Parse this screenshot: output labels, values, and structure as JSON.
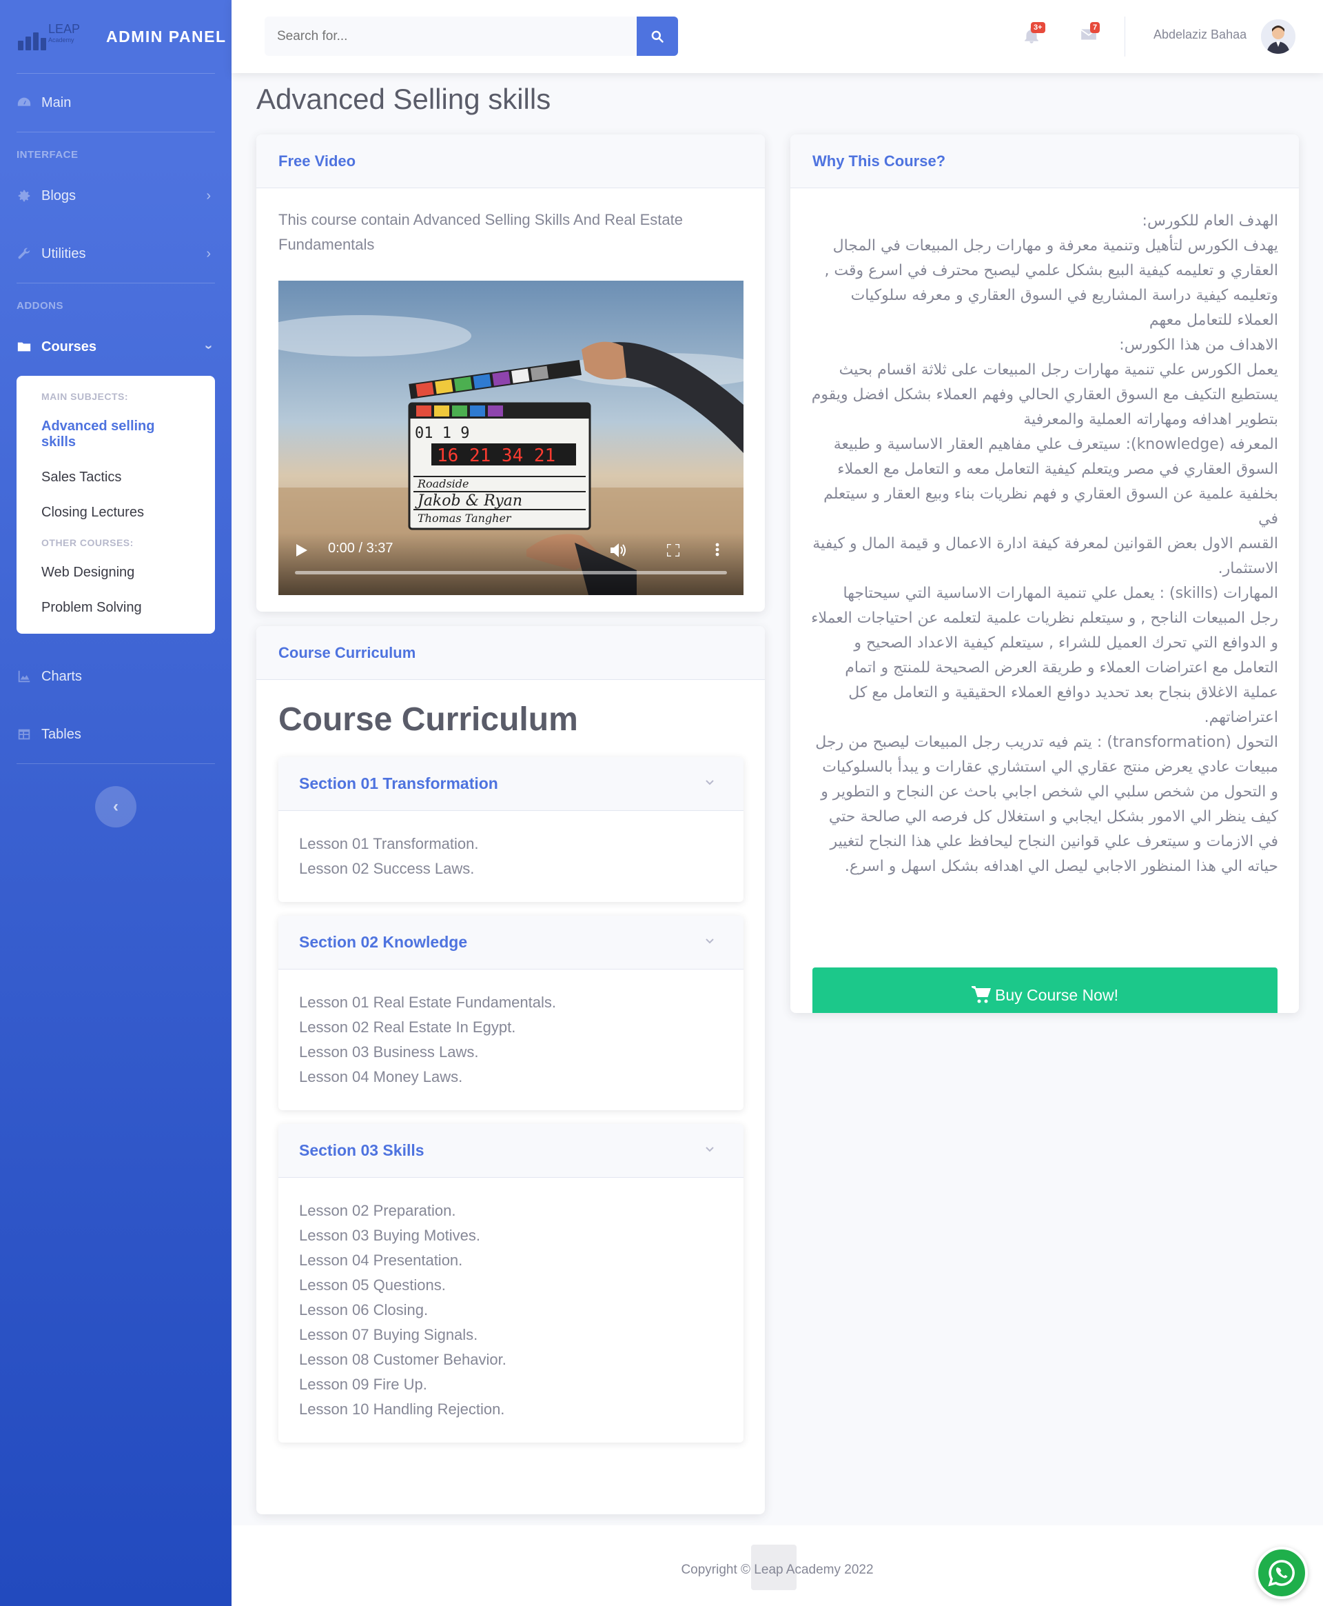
{
  "brand": {
    "logo_text": "LEAP",
    "logo_sub": "Academy",
    "title": "ADMIN PANEL"
  },
  "sidebar": {
    "main": "Main",
    "heading_interface": "INTERFACE",
    "blogs": "Blogs",
    "utilities": "Utilities",
    "heading_addons": "ADDONS",
    "courses": "Courses",
    "submenu": {
      "heading_main": "MAIN SUBJECTS:",
      "items_main": [
        "Advanced selling skills",
        "Sales Tactics",
        "Closing Lectures"
      ],
      "heading_other": "OTHER COURSES:",
      "items_other": [
        "Web Designing",
        "Problem Solving"
      ]
    },
    "charts": "Charts",
    "tables": "Tables"
  },
  "topbar": {
    "search_placeholder": "Search for...",
    "alerts_count": "3+",
    "messages_count": "7",
    "user_name": "Abdelaziz Bahaa"
  },
  "page": {
    "title": "Advanced Selling skills"
  },
  "free_video": {
    "header": "Free Video",
    "description": "This course contain Advanced Selling Skills And Real Estate Fundamentals",
    "time": "0:00 / 3:37",
    "clapper": {
      "row1": "01    1     9",
      "counter": "16 21 34 21",
      "line1": "Roadside",
      "line2": "Jakob & Ryan",
      "line3": "Thomas Tangher"
    }
  },
  "curriculum": {
    "header": "Course Curriculum",
    "title": "Course Curriculum",
    "sections": [
      {
        "title": "Section 01 Transformation",
        "lessons": [
          "Lesson 01 Transformation.",
          "Lesson 02 Success Laws."
        ]
      },
      {
        "title": "Section 02 Knowledge",
        "lessons": [
          "Lesson 01 Real Estate Fundamentals.",
          "Lesson 02 Real Estate In Egypt.",
          "Lesson 03 Business Laws.",
          "Lesson 04 Money Laws."
        ]
      },
      {
        "title": "Section 03 Skills",
        "lessons": [
          "Lesson 02 Preparation.",
          "Lesson 03 Buying Motives.",
          "Lesson 04 Presentation.",
          "Lesson 05 Questions.",
          "Lesson 06 Closing.",
          "Lesson 07 Buying Signals.",
          "Lesson 08 Customer Behavior.",
          "Lesson 09 Fire Up.",
          "Lesson 10 Handling Rejection."
        ]
      }
    ]
  },
  "why": {
    "header": "Why This Course?",
    "paragraphs": [
      "الهدف العام للكورس:",
      "يهدف الكورس لتأهيل وتنمية معرفة و مهارات رجل المبيعات في المجال العقاري و تعليمه كيفية البيع بشكل علمي ليصبح محترف في اسرع وقت , وتعليمه كيفية دراسة المشاريع في السوق العقاري و معرفه سلوكيات العملاء للتعامل معهم",
      "الاهداف من هذا الكورس:",
      "يعمل الكورس علي تنمية مهارات رجل المبيعات على ثلاثة اقسام بحيث يستطيع التكيف مع السوق العقاري الحالي وفهم العملاء بشكل افضل ويقوم بتطوير اهدافه ومهاراته العملية والمعرفية",
      "المعرفه (knowledge): سيتعرف علي مفاهيم العقار الاساسية و طبيعة السوق العقاري في مصر ويتعلم كيفية التعامل معه و التعامل مع العملاء بخلفية علمية عن السوق العقاري و فهم نظريات بناء وبيع العقار و سيتعلم في",
      "القسم الاول بعض القوانين لمعرفة كيفة ادارة الاعمال و قيمة المال و كيفية الاستثمار.",
      "المهارات (skills) : يعمل علي تنمية المهارات الاساسية التي سيحتاجها رجل المبيعات الناجح , و سيتعلم نظريات علمية لتعلمه عن احتياجات العملاء و الدوافع التي تحرك العميل للشراء , سيتعلم كيفية الاعداد الصحيح و التعامل مع اعتراضات العملاء و طريقة العرض الصحيحة للمنتج و اتمام عملية الاغلاق بنجاح بعد تحديد دوافع العملاء الحقيقية و التعامل مع كل اعتراضاتهم.",
      "التحول (transformation) : يتم فيه تدريب رجل المبيعات ليصبح من رجل مبيعات عادي يعرض منتج عقاري الي استشاري عقارات و يبدأ بالسلوكيات و التحول من شخص سلبي الي شخص اجابي باحث عن النجاح و التطوير و كيف ينظر الي الامور بشكل ايجابي و استغلال كل فرصه الي صالحة حتي في الازمات و سيتعرف علي قوانين النجاح ليحافظ علي هذا النجاح لتغيير حياته الي هذا المنظور الاجابي ليصل الي اهدافه بشكل اسهل و اسرع."
    ],
    "buy_label": "Buy Course Now!"
  },
  "footer": {
    "copyright": "Copyright © Leap Academy 2022"
  },
  "colors": {
    "primary": "#4e73df",
    "success": "#1cc88a",
    "danger": "#e74a3b",
    "whatsapp": "#1faf4b"
  }
}
